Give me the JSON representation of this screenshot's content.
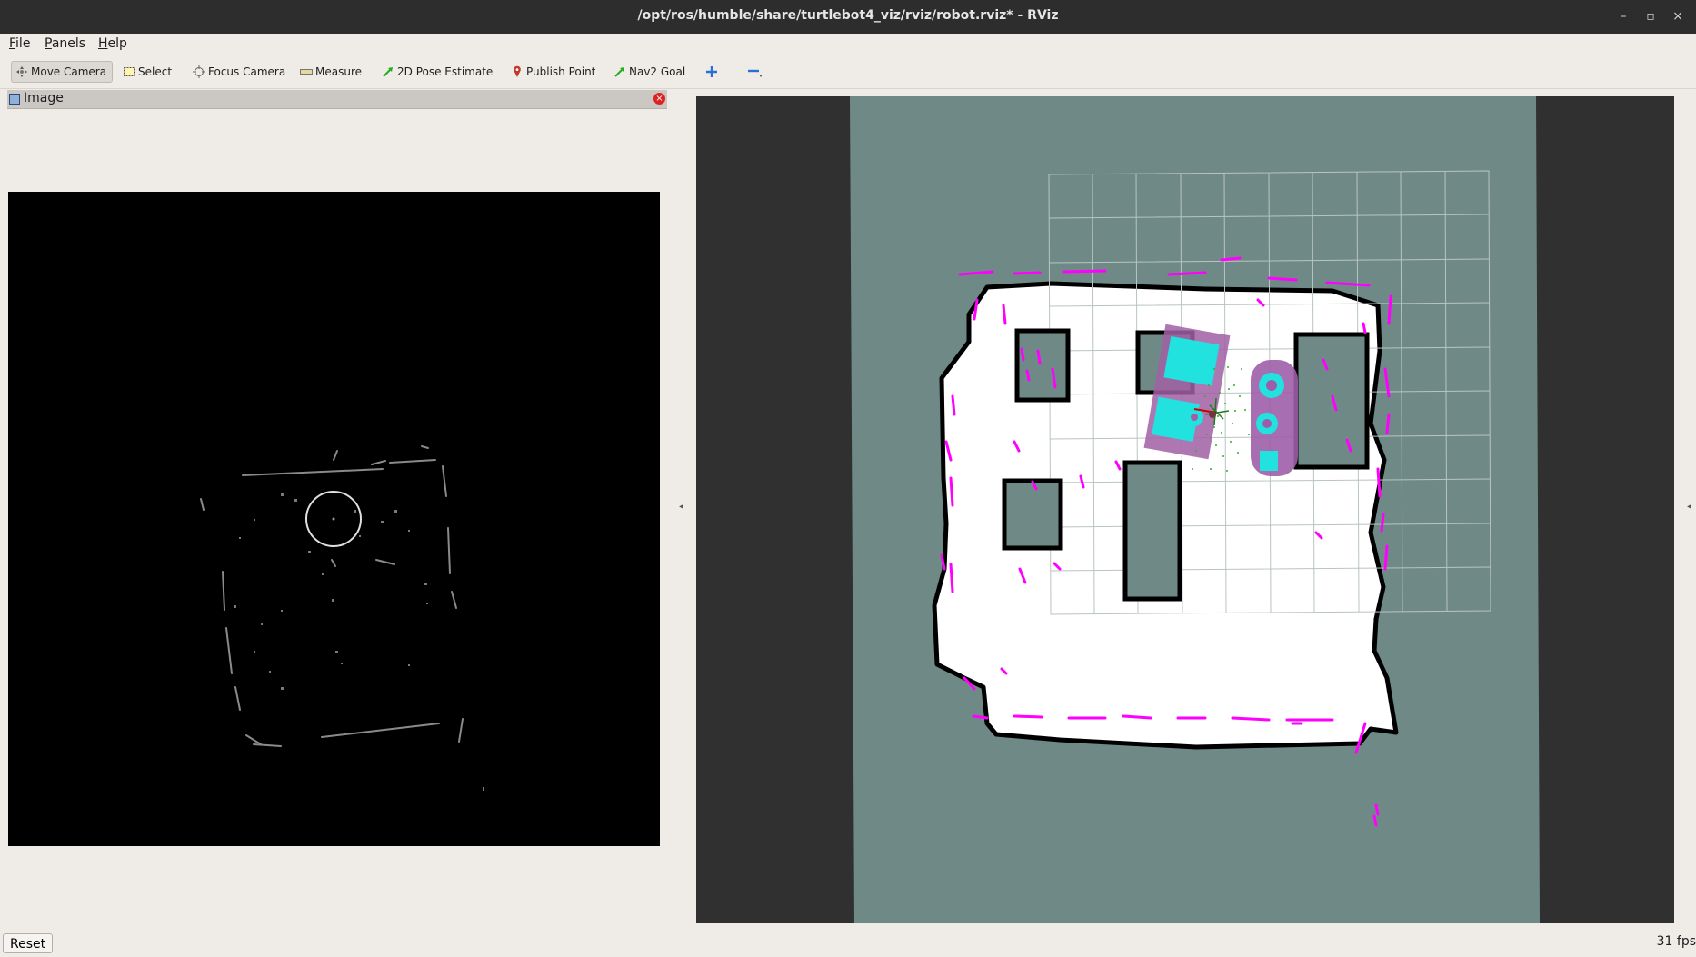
{
  "window": {
    "title": "/opt/ros/humble/share/turtlebot4_viz/rviz/robot.rviz* - RViz",
    "controls": {
      "minimize": "–",
      "maximize": "▫",
      "close": "×"
    }
  },
  "menubar": {
    "items": [
      {
        "first": "F",
        "rest": "ile"
      },
      {
        "first": "P",
        "rest": "anels"
      },
      {
        "first": "H",
        "rest": "elp"
      }
    ]
  },
  "toolbar": {
    "tools": [
      {
        "label": "Move Camera",
        "icon": "move-camera-icon",
        "active": true
      },
      {
        "label": "Select",
        "icon": "select-icon"
      },
      {
        "label": "Focus Camera",
        "icon": "focus-camera-icon"
      },
      {
        "label": "Measure",
        "icon": "measure-icon"
      },
      {
        "label": "2D Pose Estimate",
        "icon": "pose-arrow-icon"
      },
      {
        "label": "Publish Point",
        "icon": "map-pin-icon"
      },
      {
        "label": "Nav2 Goal",
        "icon": "goal-arrow-icon"
      }
    ],
    "add_tool_icon": "plus-icon",
    "remove_tool_icon": "minus-icon"
  },
  "image_panel": {
    "title": "Image",
    "close_icon": "close-icon"
  },
  "status": {
    "reset_label": "Reset",
    "fps": "31 fps"
  },
  "colors": {
    "titlebar": "#2d2d2d",
    "background": "#efebe7",
    "viewport_background": "#303030",
    "map_unknown": "#6f8a86",
    "map_free": "#ffffff",
    "map_occupied": "#000000",
    "laser_scan": "#ff00ff",
    "costmap_inflation": "#00ffff",
    "particle_cloud": "#2fb02f"
  }
}
